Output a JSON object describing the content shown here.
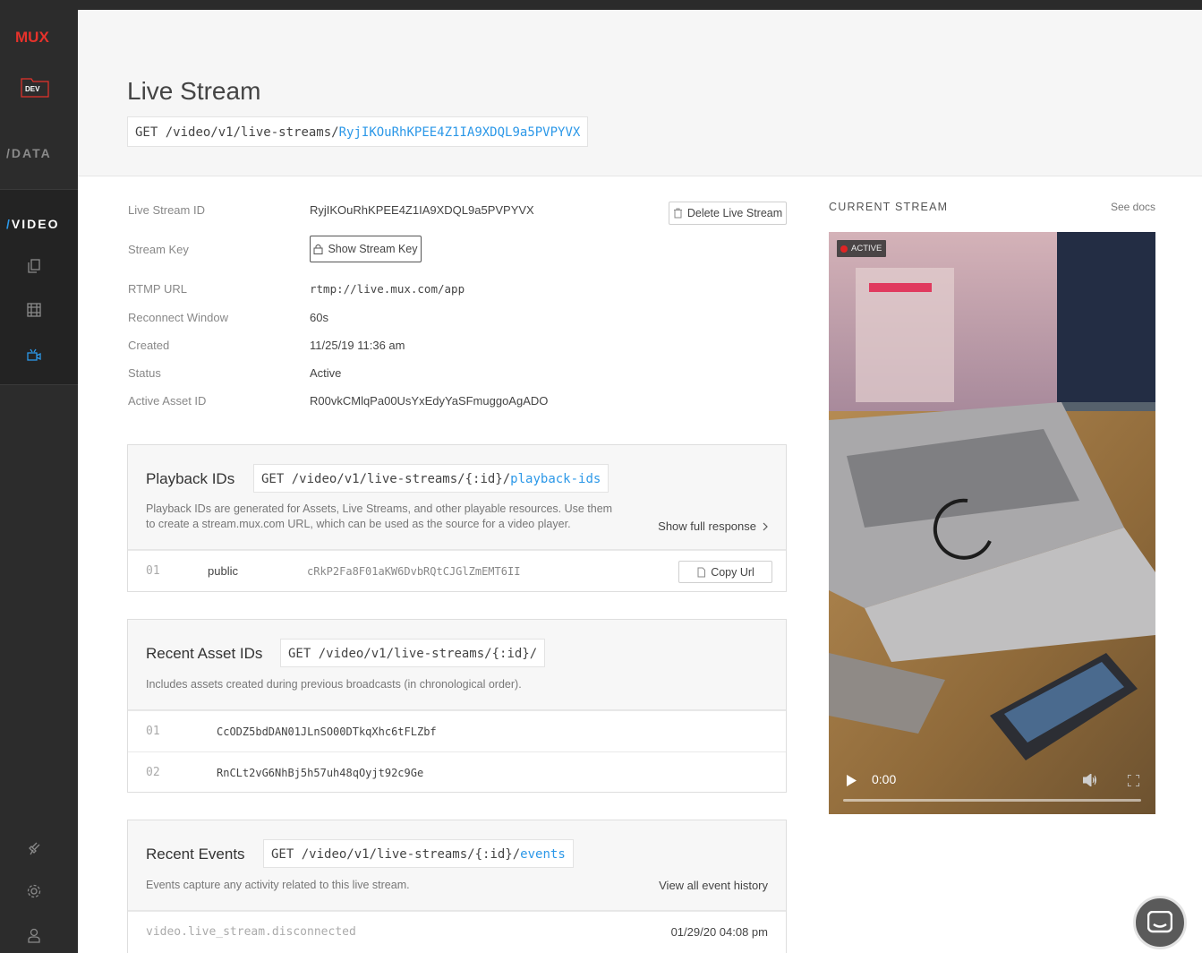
{
  "sidebar": {
    "logo": "MUX",
    "env_badge": "DEV",
    "data_label": "/DATA",
    "video_label_slash": "/",
    "video_label": "VIDEO",
    "accent_color": "#2c98e8",
    "brand_color": "#e6322b"
  },
  "header": {
    "title": "Live Stream",
    "endpoint_method": "GET",
    "endpoint_path": "/video/v1/live-streams/",
    "endpoint_id": "RyjIKOuRhKPEE4Z1IA9XDQL9a5PVPYVX"
  },
  "details": {
    "live_stream_id_label": "Live Stream ID",
    "live_stream_id": "RyjIKOuRhKPEE4Z1IA9XDQL9a5PVPYVX",
    "delete_button": "Delete Live Stream",
    "stream_key_label": "Stream Key",
    "show_stream_key_button": "Show Stream Key",
    "rtmp_url_label": "RTMP URL",
    "rtmp_url": "rtmp://live.mux.com/app",
    "reconnect_window_label": "Reconnect Window",
    "reconnect_window": "60s",
    "created_label": "Created",
    "created": "11/25/19 11:36 am",
    "status_label": "Status",
    "status": "Active",
    "active_asset_id_label": "Active Asset ID",
    "active_asset_id": "R00vkCMlqPa00UsYxEdyYaSFmuggoAgADO"
  },
  "playback": {
    "title": "Playback IDs",
    "endpoint_method": "GET",
    "endpoint_path": "/video/v1/live-streams/{:id}/",
    "endpoint_link": "playback-ids",
    "desc_line1": "Playback IDs are generated for Assets, Live Streams, and other playable resources. Use them",
    "desc_line2": "to create a stream.mux.com URL, which can be used as the source for a video player.",
    "action": "Show full response",
    "rows": [
      {
        "num": "01",
        "policy": "public",
        "id": "cRkP2Fa8F01aKW6DvbRQtCJGlZmEMT6II",
        "copy": "Copy Url"
      }
    ]
  },
  "assets": {
    "title": "Recent Asset IDs",
    "endpoint_method": "GET",
    "endpoint_path": "/video/v1/live-streams/{:id}/",
    "desc": "Includes assets created during previous broadcasts (in chronological order).",
    "rows": [
      {
        "num": "01",
        "id": "CcODZ5bdDAN01JLnSO00DTkqXhc6tFLZbf"
      },
      {
        "num": "02",
        "id": "RnCLt2vG6NhBj5h57uh48qOyjt92c9Ge"
      }
    ]
  },
  "events": {
    "title": "Recent Events",
    "endpoint_method": "GET",
    "endpoint_path": "/video/v1/live-streams/{:id}/",
    "endpoint_link": "events",
    "desc": "Events capture any activity related to this live stream.",
    "action": "View all event history",
    "rows": [
      {
        "name": "video.live_stream.disconnected",
        "time": "01/29/20 04:08 pm"
      }
    ]
  },
  "current_stream": {
    "title": "CURRENT STREAM",
    "see_docs": "See docs",
    "badge": "ACTIVE",
    "time": "0:00",
    "progress": 0
  }
}
